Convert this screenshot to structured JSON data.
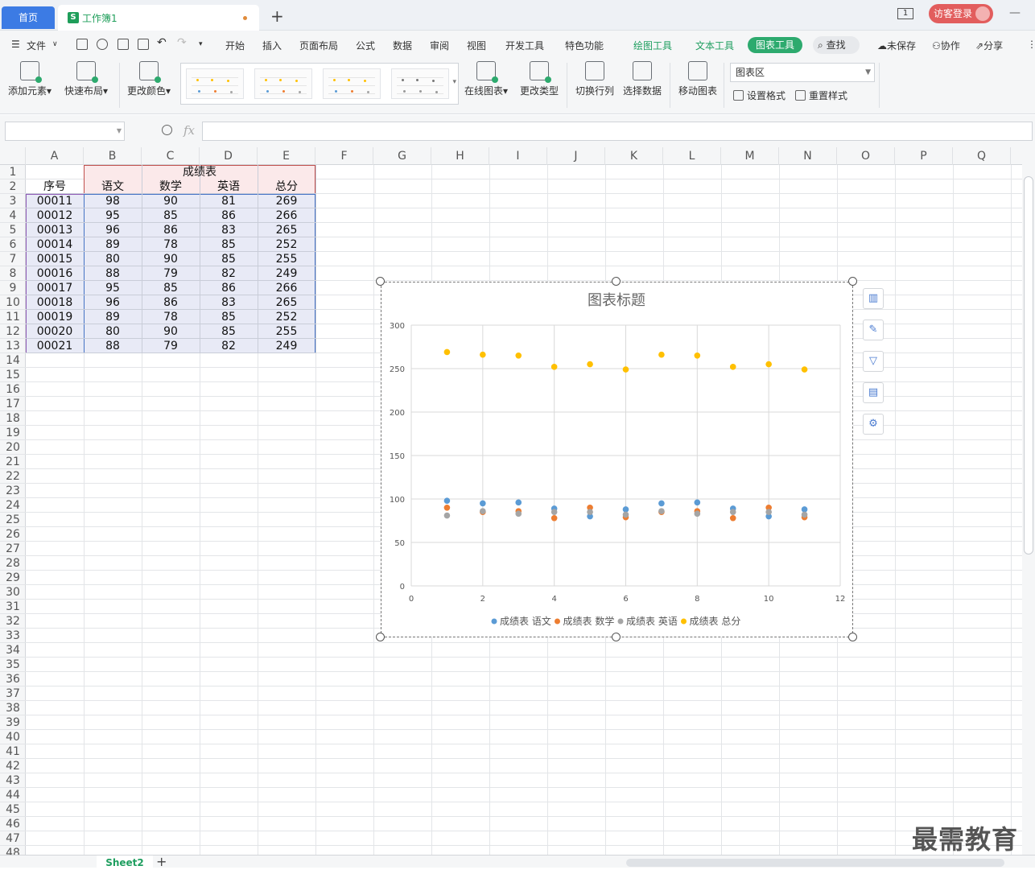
{
  "titlebar": {
    "home_tab": "首页",
    "workbook_tab": "工作簿1",
    "workbook_icon": "S",
    "new_tab": "+",
    "page_indicator": "1",
    "login_label": "访客登录",
    "minimize": "—"
  },
  "menu": {
    "file": "文件",
    "items": [
      "开始",
      "插入",
      "页面布局",
      "公式",
      "数据",
      "审阅",
      "视图",
      "开发工具",
      "特色功能"
    ],
    "tool_tabs": [
      "绘图工具",
      "文本工具"
    ],
    "active_tab": "图表工具",
    "search": "查找",
    "unsaved": "未保存",
    "collab": "协作",
    "share": "分享"
  },
  "ribbon": {
    "add_element": "添加元素",
    "quick_layout": "快速布局",
    "change_color": "更改颜色",
    "online_chart": "在线图表",
    "change_type": "更改类型",
    "switch_rowcol": "切换行列",
    "select_data": "选择数据",
    "move_chart": "移动图表",
    "chart_area_select": "图表区",
    "set_format": "设置格式",
    "reset_style": "重置样式"
  },
  "formula": {
    "fx": "fx",
    "name_value": "",
    "formula_value": ""
  },
  "sheet": {
    "columns": [
      "A",
      "B",
      "C",
      "D",
      "E",
      "F",
      "G",
      "H",
      "I",
      "J",
      "K",
      "L",
      "M",
      "N",
      "O",
      "P",
      "Q"
    ],
    "rows": [
      "1",
      "2",
      "3",
      "4",
      "5",
      "6",
      "7",
      "8",
      "9",
      "10",
      "11",
      "12",
      "13",
      "14",
      "15",
      "16",
      "17",
      "18",
      "19",
      "20",
      "21",
      "22",
      "23",
      "24",
      "25",
      "26",
      "27",
      "28",
      "29",
      "30",
      "31",
      "32",
      "33",
      "34",
      "35",
      "36",
      "37",
      "38",
      "39",
      "40",
      "41",
      "42",
      "43",
      "44",
      "45",
      "46",
      "47",
      "48"
    ],
    "table_title": "成绩表",
    "headers": [
      "序号",
      "语文",
      "数学",
      "英语",
      "总分"
    ],
    "data": [
      [
        "00011",
        "98",
        "90",
        "81",
        "269"
      ],
      [
        "00012",
        "95",
        "85",
        "86",
        "266"
      ],
      [
        "00013",
        "96",
        "86",
        "83",
        "265"
      ],
      [
        "00014",
        "89",
        "78",
        "85",
        "252"
      ],
      [
        "00015",
        "80",
        "90",
        "85",
        "255"
      ],
      [
        "00016",
        "88",
        "79",
        "82",
        "249"
      ],
      [
        "00017",
        "95",
        "85",
        "86",
        "266"
      ],
      [
        "00018",
        "96",
        "86",
        "83",
        "265"
      ],
      [
        "00019",
        "89",
        "78",
        "85",
        "252"
      ],
      [
        "00020",
        "80",
        "90",
        "85",
        "255"
      ],
      [
        "00021",
        "88",
        "79",
        "82",
        "249"
      ]
    ]
  },
  "chart_data": {
    "type": "scatter",
    "title": "图表标题",
    "xlabel": "",
    "ylabel": "",
    "xlim": [
      0,
      12
    ],
    "ylim": [
      0,
      300
    ],
    "xticks": [
      0,
      2,
      4,
      6,
      8,
      10,
      12
    ],
    "yticks": [
      0,
      50,
      100,
      150,
      200,
      250,
      300
    ],
    "grid": true,
    "legend_position": "bottom",
    "x": [
      1,
      2,
      3,
      4,
      5,
      6,
      7,
      8,
      9,
      10,
      11
    ],
    "series": [
      {
        "name": "成绩表 语文",
        "color": "#5b9bd5",
        "values": [
          98,
          95,
          96,
          89,
          80,
          88,
          95,
          96,
          89,
          80,
          88
        ]
      },
      {
        "name": "成绩表 数学",
        "color": "#ed7d31",
        "values": [
          90,
          85,
          86,
          78,
          90,
          79,
          85,
          86,
          78,
          90,
          79
        ]
      },
      {
        "name": "成绩表 英语",
        "color": "#a5a5a5",
        "values": [
          81,
          86,
          83,
          85,
          85,
          82,
          86,
          83,
          85,
          85,
          82
        ]
      },
      {
        "name": "成绩表 总分",
        "color": "#ffc000",
        "values": [
          269,
          266,
          265,
          252,
          255,
          249,
          266,
          265,
          252,
          255,
          249
        ]
      }
    ]
  },
  "side_tools": [
    "chart-elements-icon",
    "style-brush-icon",
    "filter-icon",
    "chart-type-icon",
    "settings-gear-icon"
  ],
  "bottom": {
    "sheet_tab": "Sheet2",
    "add_sheet": "+"
  },
  "watermark": "最需教育",
  "colors": {
    "accent_blue": "#3c7be4",
    "wps_green": "#1e9e5f",
    "login_red": "#e25d5d",
    "table_fill": "#e8eaf6",
    "title_fill": "#fbe9ea"
  }
}
